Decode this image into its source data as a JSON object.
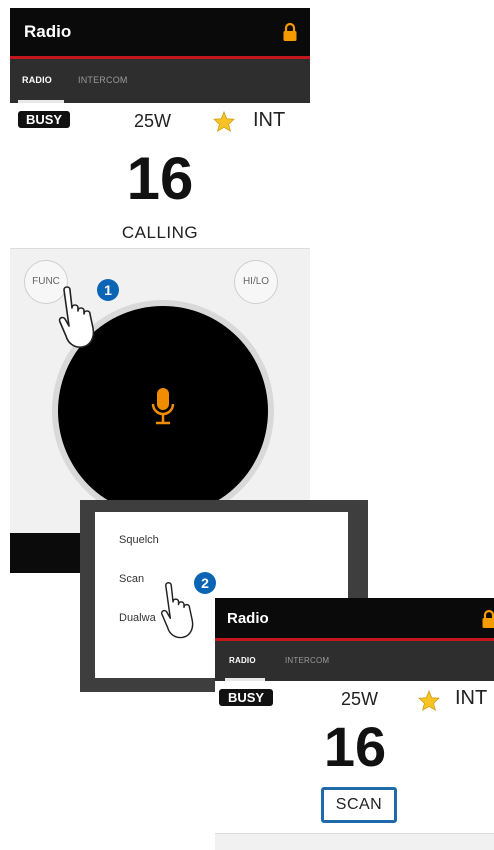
{
  "screen1": {
    "title": "Radio",
    "tabs": [
      {
        "label": "RADIO"
      },
      {
        "label": "INTERCOM"
      }
    ],
    "status": {
      "busy": "BUSY",
      "power": "25W",
      "int": "INT"
    },
    "channel": "16",
    "mode": "CALLING",
    "buttons": {
      "func": "FUNC",
      "hilo": "HI/LO"
    }
  },
  "callouts": {
    "step1": "1",
    "step2": "2"
  },
  "popup": {
    "items": [
      {
        "label": "Squelch"
      },
      {
        "label": "Scan"
      },
      {
        "label": "Dualwa"
      }
    ]
  },
  "screen2": {
    "title": "Radio",
    "tabs": [
      {
        "label": "RADIO"
      },
      {
        "label": "INTERCOM"
      }
    ],
    "status": {
      "busy": "BUSY",
      "power": "25W",
      "int": "INT"
    },
    "channel": "16",
    "mode": "SCAN"
  },
  "colors": {
    "titlebar": "#0a0a0a",
    "accent_red": "#c4161c",
    "lock_orange": "#f59a00",
    "mic_orange": "#f28c00",
    "star_yellow": "#f7c325",
    "callout_blue": "#0b65b4",
    "highlight_blue": "#1f6aab"
  }
}
